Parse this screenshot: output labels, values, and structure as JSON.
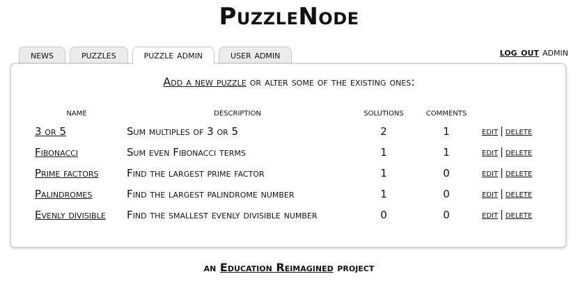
{
  "site": {
    "title": "PuzzleNode"
  },
  "tabs": [
    {
      "label": "news",
      "active": false
    },
    {
      "label": "puzzles",
      "active": false
    },
    {
      "label": "puzzle admin",
      "active": true
    },
    {
      "label": "user admin",
      "active": false
    }
  ],
  "session": {
    "logout_label": "log out",
    "username": "admin"
  },
  "intro": {
    "link_text": "Add a new puzzle",
    "rest_text": "or alter some of the existing ones:"
  },
  "table": {
    "headers": [
      "name",
      "description",
      "solutions",
      "comments"
    ],
    "edit_label": "edit",
    "delete_label": "delete",
    "separator": "|",
    "rows": [
      {
        "name": "3 or 5",
        "description": "Sum multiples of 3 or 5",
        "solutions": "2",
        "comments": "1"
      },
      {
        "name": "Fibonacci",
        "description": "Sum even Fibonacci terms",
        "solutions": "1",
        "comments": "1"
      },
      {
        "name": "Prime factors",
        "description": "Find the largest prime factor",
        "solutions": "1",
        "comments": "0"
      },
      {
        "name": "Palindromes",
        "description": "Find the largest palindrome number",
        "solutions": "1",
        "comments": "0"
      },
      {
        "name": "Evenly divisible",
        "description": "Find the smallest evenly divisible number",
        "solutions": "0",
        "comments": "0"
      }
    ]
  },
  "footer": {
    "prefix": "an",
    "link_text": "Education Reimagined",
    "suffix": "project"
  }
}
